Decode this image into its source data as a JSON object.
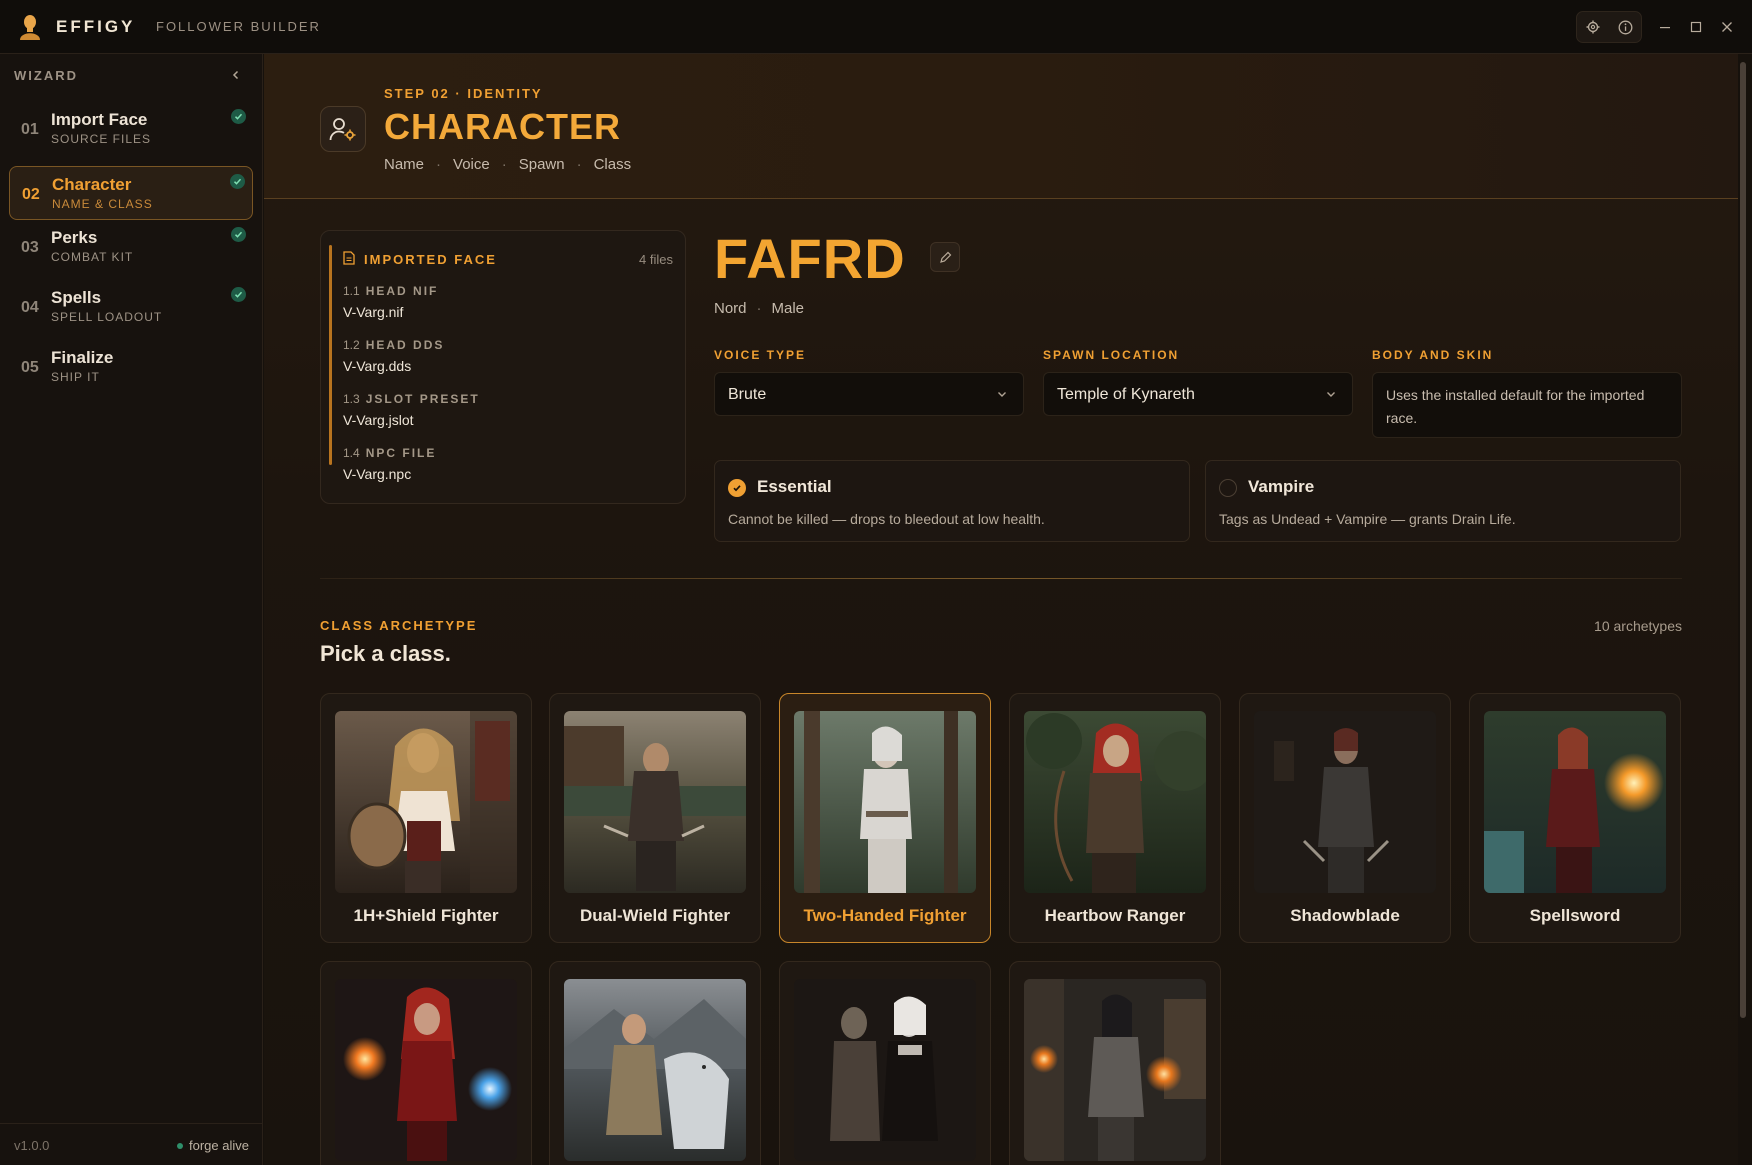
{
  "app": {
    "brand": "EFFIGY",
    "subtitle": "FOLLOWER BUILDER",
    "version": "v1.0.0",
    "status": "forge alive"
  },
  "sidebar": {
    "title": "WIZARD",
    "steps": [
      {
        "num": "01",
        "label": "Import Face",
        "sub": "SOURCE FILES",
        "done": true
      },
      {
        "num": "02",
        "label": "Character",
        "sub": "NAME & CLASS",
        "done": true,
        "active": true
      },
      {
        "num": "03",
        "label": "Perks",
        "sub": "COMBAT KIT",
        "done": true
      },
      {
        "num": "04",
        "label": "Spells",
        "sub": "SPELL LOADOUT",
        "done": true
      },
      {
        "num": "05",
        "label": "Finalize",
        "sub": "SHIP IT",
        "done": false
      }
    ]
  },
  "header": {
    "kicker": "STEP 02 · IDENTITY",
    "title": "CHARACTER",
    "tabs": [
      "Name",
      "Voice",
      "Spawn",
      "Class"
    ],
    "tab_separator": "·"
  },
  "imported_face": {
    "title": "IMPORTED FACE",
    "count": "4 files",
    "files": [
      {
        "idx": "1.1",
        "label": "HEAD NIF",
        "file": "V-Varg.nif"
      },
      {
        "idx": "1.2",
        "label": "HEAD DDS",
        "file": "V-Varg.dds"
      },
      {
        "idx": "1.3",
        "label": "JSLOT PRESET",
        "file": "V-Varg.jslot"
      },
      {
        "idx": "1.4",
        "label": "NPC FILE",
        "file": "V-Varg.npc"
      }
    ]
  },
  "character": {
    "name": "FAFRD",
    "race": "Nord",
    "sex": "Male",
    "separator": "·"
  },
  "fields": {
    "voice_label": "VOICE TYPE",
    "voice_value": "Brute",
    "spawn_label": "SPAWN LOCATION",
    "spawn_value": "Temple of Kynareth",
    "skin_label": "BODY AND SKIN",
    "skin_value": "Uses the installed default for the imported race."
  },
  "toggles": {
    "essential": {
      "title": "Essential",
      "desc": "Cannot be killed — drops to bleedout at low health.",
      "checked": true
    },
    "vampire": {
      "title": "Vampire",
      "desc": "Tags as Undead + Vampire — grants Drain Life.",
      "checked": false
    }
  },
  "classes": {
    "kicker": "CLASS ARCHETYPE",
    "title": "Pick a class.",
    "count": "10 archetypes",
    "selected": "Two-Handed Fighter",
    "items": [
      {
        "name": "1H+Shield Fighter",
        "icon": "portrait-shield-fighter"
      },
      {
        "name": "Dual-Wield Fighter",
        "icon": "portrait-dual-wield"
      },
      {
        "name": "Two-Handed Fighter",
        "icon": "portrait-two-handed"
      },
      {
        "name": "Heartbow Ranger",
        "icon": "portrait-ranger"
      },
      {
        "name": "Shadowblade",
        "icon": "portrait-shadowblade"
      },
      {
        "name": "Spellsword",
        "icon": "portrait-spellsword"
      },
      {
        "name": "",
        "icon": "portrait-mage"
      },
      {
        "name": "",
        "icon": "portrait-wolf-druid"
      },
      {
        "name": "",
        "icon": "portrait-necromancer"
      },
      {
        "name": "",
        "icon": "portrait-battlemage"
      }
    ]
  },
  "colors": {
    "accent": "#f0a033",
    "bg": "#16110c",
    "success": "#1e5b46"
  }
}
